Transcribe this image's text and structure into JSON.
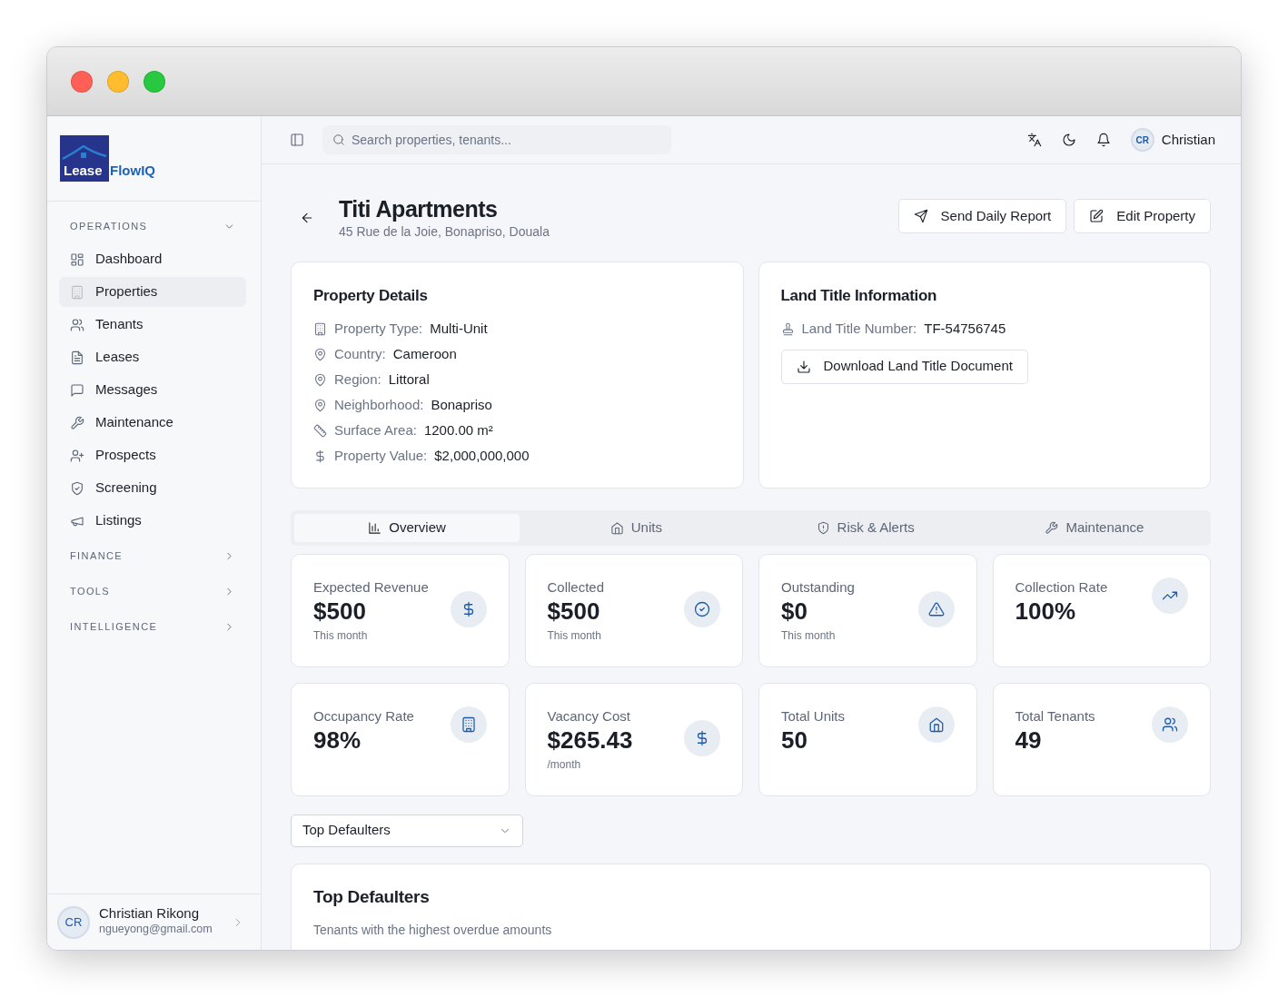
{
  "logo": {
    "text_1": "Lease",
    "text_2": "FlowIQ"
  },
  "sidebar": {
    "sections": [
      {
        "label": "OPERATIONS",
        "expanded": true,
        "items": [
          {
            "label": "Dashboard",
            "selected": false
          },
          {
            "label": "Properties",
            "selected": true
          },
          {
            "label": "Tenants",
            "selected": false
          },
          {
            "label": "Leases",
            "selected": false
          },
          {
            "label": "Messages",
            "selected": false
          },
          {
            "label": "Maintenance",
            "selected": false
          },
          {
            "label": "Prospects",
            "selected": false
          },
          {
            "label": "Screening",
            "selected": false
          },
          {
            "label": "Listings",
            "selected": false
          }
        ]
      },
      {
        "label": "FINANCE",
        "expanded": false
      },
      {
        "label": "TOOLS",
        "expanded": false
      },
      {
        "label": "INTELLIGENCE",
        "expanded": false
      }
    ],
    "user": {
      "initials": "CR",
      "name": "Christian Rikong",
      "email": "ngueyong@gmail.com"
    }
  },
  "topbar": {
    "search": {
      "placeholder": "Search properties, tenants..."
    },
    "user": {
      "initials": "CR",
      "name": "Christian"
    }
  },
  "header": {
    "title": "Titi Apartments",
    "address": "45 Rue de la Joie, Bonapriso, Douala",
    "buttons": [
      "Send Daily Report",
      "Edit Property"
    ]
  },
  "property_details": {
    "title": "Property Details",
    "rows": [
      {
        "label": "Property Type:",
        "value": "Multi-Unit"
      },
      {
        "label": "Country:",
        "value": "Cameroon"
      },
      {
        "label": "Region:",
        "value": "Littoral"
      },
      {
        "label": "Neighborhood:",
        "value": "Bonapriso"
      },
      {
        "label": "Surface Area:",
        "value": "1200.00 m²"
      },
      {
        "label": "Property Value:",
        "value": "$2,000,000,000"
      }
    ]
  },
  "land_title": {
    "title": "Land Title Information",
    "rows": [
      {
        "label": "Land Title Number:",
        "value": "TF-54756745"
      }
    ],
    "button": "Download Land Title Document"
  },
  "tabs": [
    {
      "label": "Overview",
      "selected": true
    },
    {
      "label": "Units",
      "selected": false
    },
    {
      "label": "Risk & Alerts",
      "selected": false
    },
    {
      "label": "Maintenance",
      "selected": false
    }
  ],
  "stats": [
    {
      "label": "Expected Revenue",
      "value": "$500",
      "note": "This month"
    },
    {
      "label": "Collected",
      "value": "$500",
      "note": "This month"
    },
    {
      "label": "Outstanding",
      "value": "$0",
      "note": "This month"
    },
    {
      "label": "Collection Rate",
      "value": "100%"
    },
    {
      "label": "Occupancy Rate",
      "value": "98%"
    },
    {
      "label": "Vacancy Cost",
      "value": "$265.43",
      "note": "/month"
    },
    {
      "label": "Total Units",
      "value": "50"
    },
    {
      "label": "Total Tenants",
      "value": "49"
    }
  ],
  "report_select": {
    "value": "Top Defaulters"
  },
  "defaulters": {
    "title": "Top Defaulters",
    "subtitle": "Tenants with the highest overdue amounts"
  }
}
